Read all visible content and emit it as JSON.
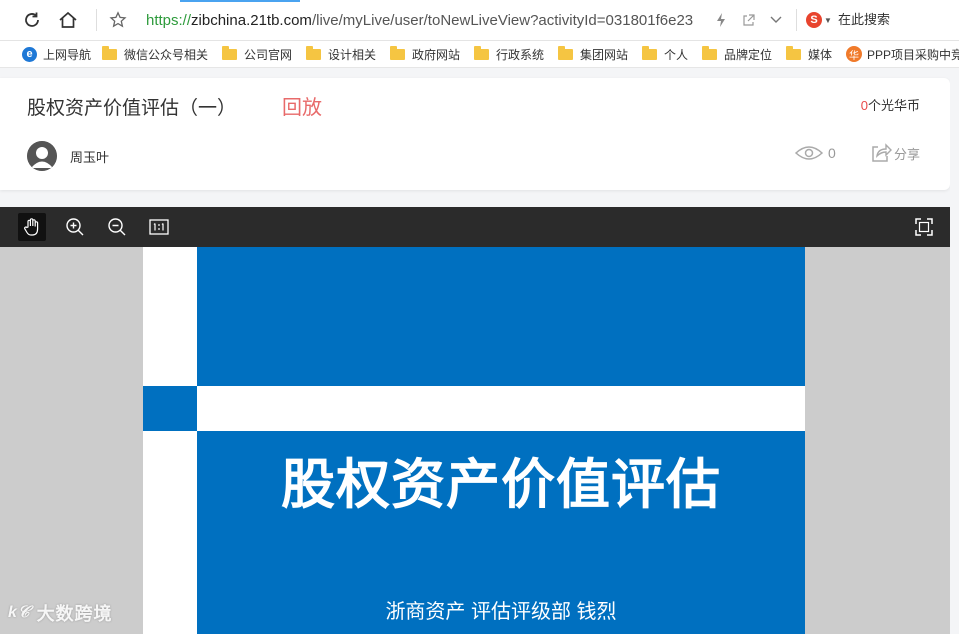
{
  "browser": {
    "url_scheme": "https://",
    "url_host": "zibchina.21tb.com",
    "url_path": "/live/myLive/user/toNewLiveView?activityId=031801f6e23",
    "search_placeholder": "在此搜索",
    "search_engine_letter": "S"
  },
  "bookmarks": [
    {
      "label": "上网导航",
      "icon": "ie-icon"
    },
    {
      "label": "微信公众号相关",
      "icon": "folder-icon"
    },
    {
      "label": "公司官网",
      "icon": "folder-icon"
    },
    {
      "label": "设计相关",
      "icon": "folder-icon"
    },
    {
      "label": "政府网站",
      "icon": "folder-icon"
    },
    {
      "label": "行政系统",
      "icon": "folder-icon"
    },
    {
      "label": "集团网站",
      "icon": "folder-icon"
    },
    {
      "label": "个人",
      "icon": "folder-icon"
    },
    {
      "label": "品牌定位",
      "icon": "folder-icon"
    },
    {
      "label": "媒体",
      "icon": "folder-icon"
    },
    {
      "label": "PPP项目采购中竞",
      "icon": "hua-icon",
      "icon_text": "华"
    }
  ],
  "live": {
    "title": "股权资产价值评估（一）",
    "status": "回放",
    "coins_count": "0",
    "coins_label": "个光华币",
    "author": "周玉叶",
    "views": "0",
    "share_label": "分享"
  },
  "slide": {
    "title": "股权资产价值评估",
    "subtitle": "浙商资产 评估评级部 钱烈"
  },
  "watermark": {
    "logo": "k𝒞",
    "text": "大数跨境"
  },
  "colors": {
    "slide_blue": "#0070c0",
    "replay_red": "#e86a6a",
    "url_green": "#2e9b3c",
    "viewer_bar": "#2b2b2b"
  }
}
